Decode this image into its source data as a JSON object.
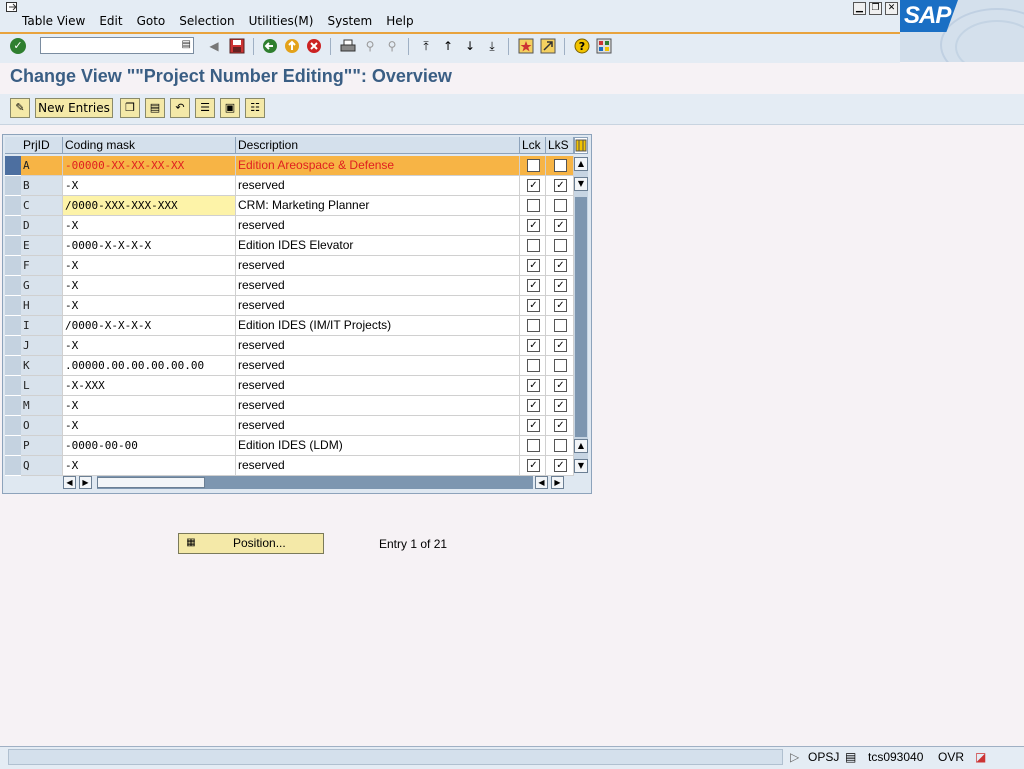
{
  "menubar": {
    "items": [
      "Table View",
      "Edit",
      "Goto",
      "Selection",
      "Utilities(M)",
      "System",
      "Help"
    ]
  },
  "logo": {
    "text": "SAP"
  },
  "toolbar": {
    "command_value": "",
    "icons": [
      "enter-icon",
      "back-icon",
      "save-icon",
      "back-arrow-icon",
      "exit-icon",
      "cancel-icon",
      "print-icon",
      "find-icon",
      "find-next-icon",
      "first-page-icon",
      "previous-page-icon",
      "next-page-icon",
      "last-page-icon",
      "create-session-icon",
      "shortcut-icon",
      "help-icon",
      "customize-layout-icon"
    ]
  },
  "title": "Change View \"\"Project Number Editing\"\": Overview",
  "app_toolbar": {
    "new_entries_label": "New Entries"
  },
  "table": {
    "headers": {
      "id": "PrjID",
      "mask": "Coding mask",
      "desc": "Description",
      "lck": "Lck",
      "lks": "LkS"
    },
    "rows": [
      {
        "id": "A",
        "mask": "-00000-XX-XX-XX-XX",
        "desc": "Edition Areospace & Defense",
        "lck": false,
        "lks": false,
        "highlight": true
      },
      {
        "id": "B",
        "mask": "-X",
        "desc": "reserved",
        "lck": true,
        "lks": true
      },
      {
        "id": "C",
        "mask": "/0000-XXX-XXX-XXX",
        "desc": "CRM: Marketing Planner",
        "lck": false,
        "lks": false,
        "focus": true
      },
      {
        "id": "D",
        "mask": "-X",
        "desc": "reserved",
        "lck": true,
        "lks": true
      },
      {
        "id": "E",
        "mask": "-0000-X-X-X-X",
        "desc": "Edition IDES Elevator",
        "lck": false,
        "lks": false
      },
      {
        "id": "F",
        "mask": "-X",
        "desc": "reserved",
        "lck": true,
        "lks": true
      },
      {
        "id": "G",
        "mask": "-X",
        "desc": "reserved",
        "lck": true,
        "lks": true
      },
      {
        "id": "H",
        "mask": "-X",
        "desc": "reserved",
        "lck": true,
        "lks": true
      },
      {
        "id": "I",
        "mask": "/0000-X-X-X-X",
        "desc": "Edition IDES (IM/IT Projects)",
        "lck": false,
        "lks": false
      },
      {
        "id": "J",
        "mask": "-X",
        "desc": "reserved",
        "lck": true,
        "lks": true
      },
      {
        "id": "K",
        "mask": ".00000.00.00.00.00.00",
        "desc": "reserved",
        "lck": false,
        "lks": false
      },
      {
        "id": "L",
        "mask": "-X-XXX",
        "desc": "reserved",
        "lck": true,
        "lks": true
      },
      {
        "id": "M",
        "mask": "-X",
        "desc": "reserved",
        "lck": true,
        "lks": true
      },
      {
        "id": "O",
        "mask": "-X",
        "desc": "reserved",
        "lck": true,
        "lks": true
      },
      {
        "id": "P",
        "mask": "-0000-00-00",
        "desc": "Edition IDES (LDM)",
        "lck": false,
        "lks": false
      },
      {
        "id": "Q",
        "mask": "-X",
        "desc": "reserved",
        "lck": true,
        "lks": true
      }
    ]
  },
  "position_button": {
    "label": "Position..."
  },
  "entry_info": "Entry 1 of 21",
  "status": {
    "transaction": "OPSJ",
    "server": "tcs093040",
    "mode": "OVR"
  }
}
